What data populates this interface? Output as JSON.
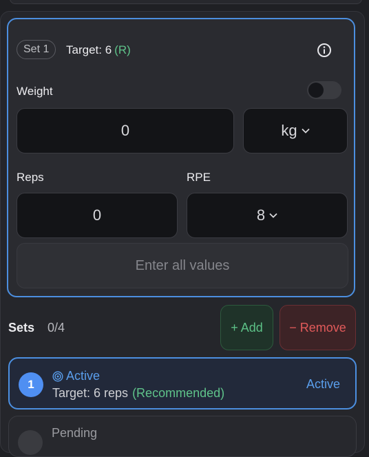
{
  "current_set": {
    "pill": "Set 1",
    "target": "Target: 6",
    "target_tag": "(R)",
    "info_icon": "info-circle-icon",
    "weight_label": "Weight",
    "weight_value": "0",
    "weight_unit": "kg",
    "reps_label": "Reps",
    "reps_value": "0",
    "rpe_label": "RPE",
    "rpe_value": "8",
    "submit_label": "Enter all values"
  },
  "sets": {
    "label": "Sets",
    "count": "0/4",
    "add_label": "+ Add",
    "remove_label": "− Remove",
    "rows": [
      {
        "number": "1",
        "status": "Active",
        "target": "Target: 6 reps",
        "tag": "(Recommended)",
        "right_status": "Active"
      },
      {
        "status": "Pending"
      }
    ]
  },
  "colors": {
    "accent": "#4c8fe0",
    "success": "#5fc38a",
    "danger": "#e25a5a"
  }
}
